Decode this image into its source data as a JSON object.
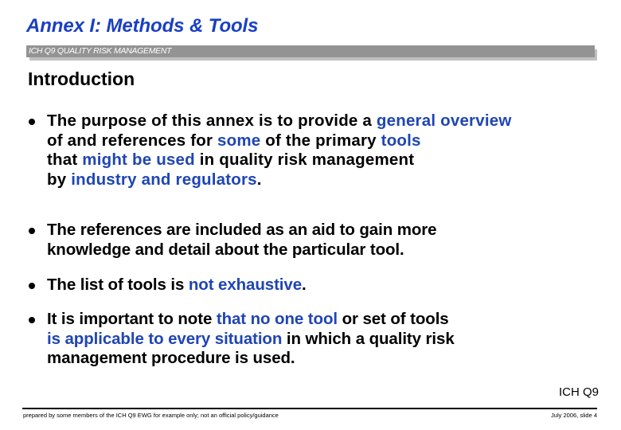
{
  "slide": {
    "title": "Annex I: Methods & Tools",
    "band_label": "ICH Q9 QUALITY RISK MANAGEMENT",
    "heading": "Introduction",
    "colors": {
      "title": "#1a3fc4",
      "highlight": "#1f45b5",
      "band": "#939393",
      "band_shadow": "#c0c0c0",
      "text": "#000000"
    },
    "bullets": [
      {
        "lines": [
          [
            {
              "text": "The purpose of this annex is to provide a ",
              "highlight": false
            },
            {
              "text": "general overview",
              "highlight": true
            }
          ],
          [
            {
              "text": "of and references for ",
              "highlight": false
            },
            {
              "text": "some",
              "highlight": true
            },
            {
              "text": " of the primary ",
              "highlight": false
            },
            {
              "text": "tools",
              "highlight": true
            }
          ],
          [
            {
              "text": "that ",
              "highlight": false
            },
            {
              "text": "might be used",
              "highlight": true
            },
            {
              "text": " in quality risk management",
              "highlight": false
            }
          ],
          [
            {
              "text": "by ",
              "highlight": false
            },
            {
              "text": "industry and regulators",
              "highlight": true
            },
            {
              "text": ".",
              "highlight": false
            }
          ]
        ]
      },
      {
        "lines": [
          [
            {
              "text": "The references are included as an aid to gain more",
              "highlight": false
            }
          ],
          [
            {
              "text": "knowledge and detail about the particular tool.",
              "highlight": false
            }
          ]
        ]
      },
      {
        "lines": [
          [
            {
              "text": "The list of tools is ",
              "highlight": false
            },
            {
              "text": "not exhaustive",
              "highlight": true
            },
            {
              "text": ".",
              "highlight": false
            }
          ]
        ]
      },
      {
        "lines": [
          [
            {
              "text": "It is important to note ",
              "highlight": false
            },
            {
              "text": "that no one tool",
              "highlight": true
            },
            {
              "text": " or set of tools",
              "highlight": false
            }
          ],
          [
            {
              "text": "is applicable to every situation",
              "highlight": true
            },
            {
              "text": " in which a quality risk",
              "highlight": false
            }
          ],
          [
            {
              "text": "management procedure is used.",
              "highlight": false
            }
          ]
        ]
      }
    ],
    "tag": "ICH Q9",
    "footer": {
      "left": "prepared by some members of the ICH Q9 EWG for example only; not an official policy/guidance",
      "right": "July 2006, slide 4"
    }
  }
}
